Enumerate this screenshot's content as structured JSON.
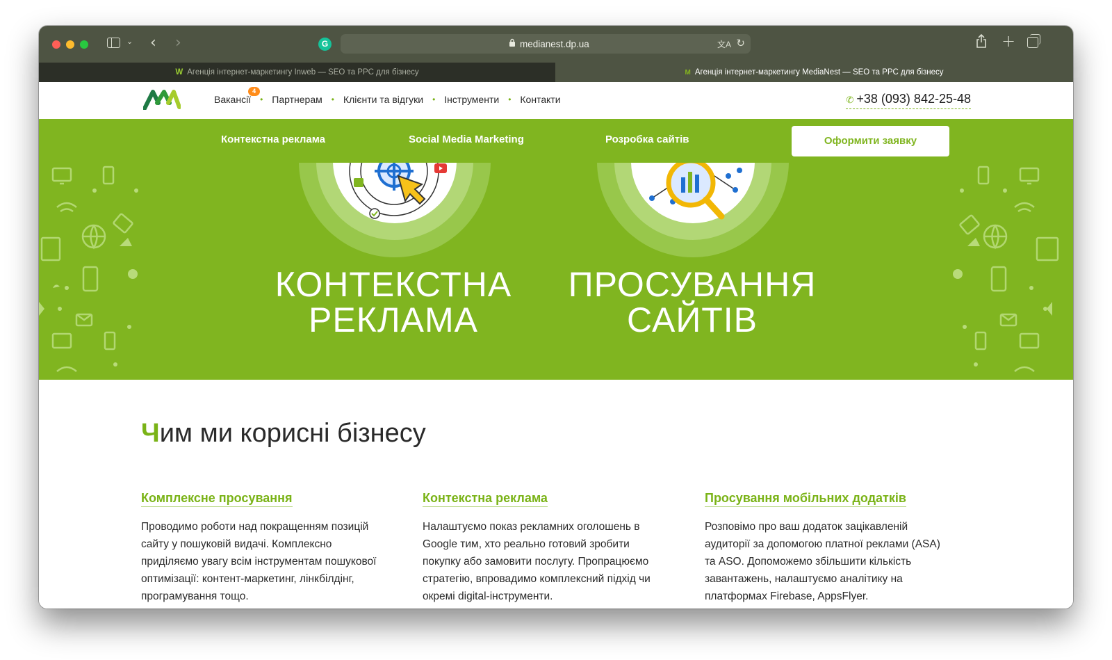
{
  "browser": {
    "url": "medianest.dp.ua",
    "tabs": [
      {
        "title": "Агенція інтернет-маркетингу Inweb — SEO та PPC для бізнесу",
        "favicon": "W",
        "active": false
      },
      {
        "title": "Агенція інтернет-маркетингу MediaNest — SEO та PPC для бізнесу",
        "favicon": "M",
        "active": true
      }
    ],
    "icons": {
      "sidebar": "sidebar-icon",
      "back": "‹",
      "forward": "›",
      "grammarly": "G",
      "lock": "🔒",
      "translate": "文A",
      "reload": "↻",
      "share": "⇪",
      "new_tab": "+",
      "tabs": "tabs-overview-icon"
    }
  },
  "header": {
    "nav": [
      {
        "label": "Вакансії",
        "badge": "4"
      },
      {
        "label": "Партнерам"
      },
      {
        "label": "Клієнти та відгуки"
      },
      {
        "label": "Інструменти"
      },
      {
        "label": "Контакти"
      }
    ],
    "phone": "+38 (093) 842-25-48",
    "phone_icon": "✆"
  },
  "green_nav": {
    "links": [
      "Контекстна реклама",
      "Social Media Marketing",
      "Розробка сайтів"
    ],
    "cta": "Оформити заявку"
  },
  "hero": {
    "cards": [
      {
        "line1": "КОНТЕКСТНА",
        "line2": "РЕКЛАМА"
      },
      {
        "line1": "ПРОСУВАННЯ",
        "line2": "САЙТІВ"
      }
    ]
  },
  "benefits": {
    "title_first": "Ч",
    "title_rest": "им ми корисні бізнесу",
    "columns": [
      {
        "title": "Комплексне просування",
        "text": "Проводимо роботи над покращенням позицій сайту у пошуковій видачі. Комплексно приділяємо увагу всім інструментам пошукової оптимізації: контент-маркетинг, лінкбілдінг, програмування тощо."
      },
      {
        "title": "Контекстна реклама",
        "text": "Налаштуємо показ рекламних оголошень в Google тим, хто реально готовий зробити покупку або замовити послугу. Пропрацюємо стратегію, впровадимо комплексний підхід чи окремі digital-інструменти."
      },
      {
        "title": "Просування мобільних додатків",
        "text": "Розповімо про ваш додаток зацікавленій аудиторії за допомогою платної реклами (ASA) та ASO. Допоможемо збільшити кількість завантажень, налаштуємо аналітику на платформах Firebase, AppsFlyer."
      }
    ]
  },
  "colors": {
    "brand_green": "#80b520",
    "accent_green": "#7ab317",
    "badge_orange": "#ff8c1a",
    "toolbar": "#4e5443"
  }
}
